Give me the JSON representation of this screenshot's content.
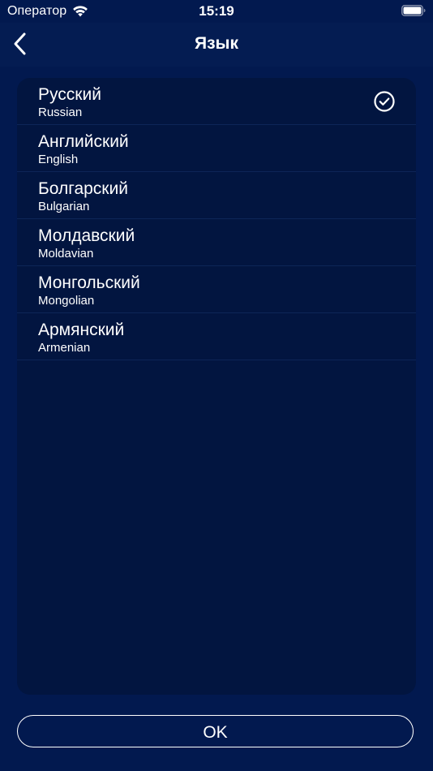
{
  "status_bar": {
    "carrier": "Оператор",
    "time": "15:19",
    "wifi_icon": "wifi-icon",
    "battery_icon": "battery-icon",
    "battery_level": 1.0
  },
  "nav": {
    "back_icon": "chevron-left-icon",
    "title": "Язык"
  },
  "languages": [
    {
      "name": "Русский",
      "subtitle": "Russian",
      "selected": true
    },
    {
      "name": "Английский",
      "subtitle": "English",
      "selected": false
    },
    {
      "name": "Болгарский",
      "subtitle": "Bulgarian",
      "selected": false
    },
    {
      "name": "Молдавский",
      "subtitle": "Moldavian",
      "selected": false
    },
    {
      "name": "Монгольский",
      "subtitle": "Mongolian",
      "selected": false
    },
    {
      "name": "Армянский",
      "subtitle": "Armenian",
      "selected": false
    }
  ],
  "selected_icon": "checkmark-circle-icon",
  "ok_button": {
    "label": "OK"
  },
  "colors": {
    "background": "#02194f",
    "nav_background": "#041c52",
    "panel_background": "#021540",
    "text": "#ffffff"
  }
}
